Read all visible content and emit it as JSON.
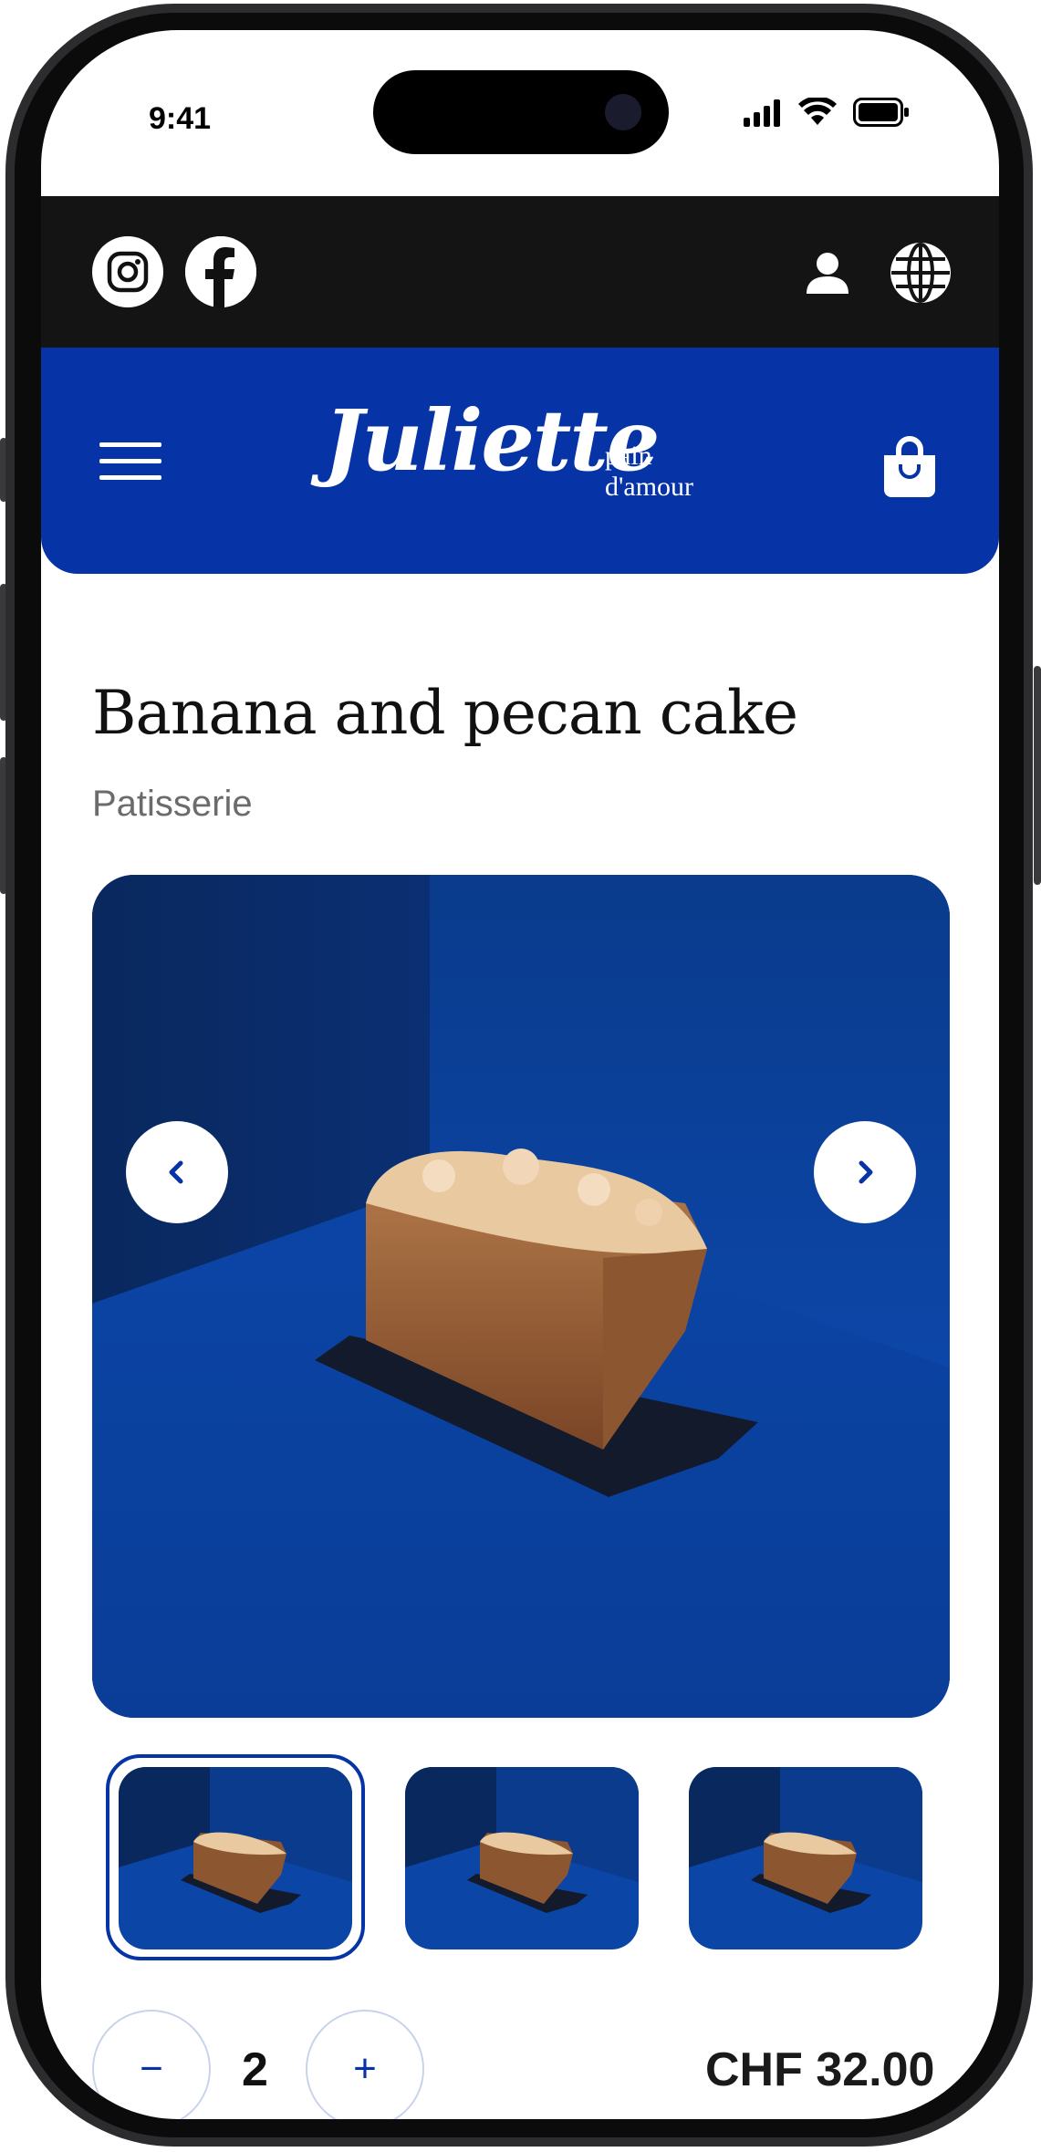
{
  "status_bar": {
    "time": "9:41"
  },
  "social": {
    "instagram": "instagram-icon",
    "facebook": "facebook-icon"
  },
  "header_icons": {
    "account": "user-icon",
    "language": "globe-icon",
    "menu": "hamburger-icon",
    "cart": "shopping-bag-icon"
  },
  "brand": {
    "name": "Juliette",
    "tagline": "pain d'amour",
    "color": "#0633a5"
  },
  "product": {
    "title": "Banana and pecan cake",
    "category": "Patisserie",
    "gallery": {
      "selected_index": 0,
      "count": 3
    }
  },
  "cart": {
    "quantity": "2",
    "minus_label": "−",
    "plus_label": "+",
    "price": "CHF 32.00"
  }
}
